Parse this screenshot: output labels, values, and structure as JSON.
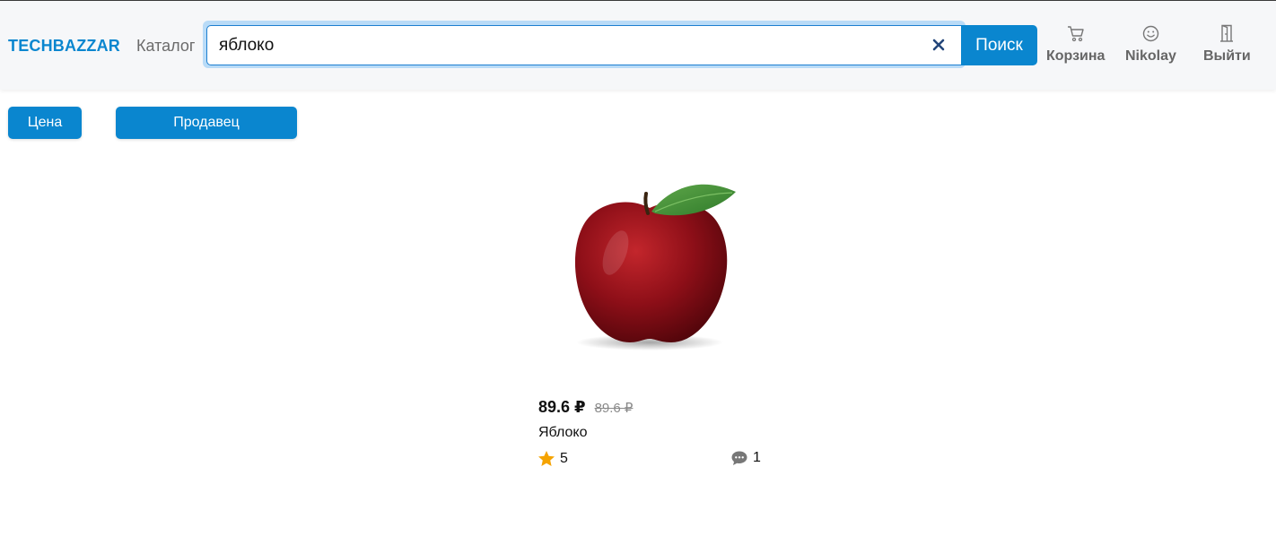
{
  "header": {
    "logo": "TECHBAZZAR",
    "catalog": "Каталог",
    "search": {
      "value": "яблоко",
      "button": "Поиск"
    },
    "nav": {
      "cart": {
        "label": "Корзина",
        "icon": "cart-icon"
      },
      "user": {
        "label": "Nikolay",
        "icon": "smiley-icon"
      },
      "logout": {
        "label": "Выйти",
        "icon": "door-icon"
      }
    }
  },
  "filters": {
    "price": "Цена",
    "seller": "Продавец"
  },
  "products": [
    {
      "image": "apple-image",
      "price": "89.6 ₽",
      "old_price": "89.6 ₽",
      "title": "Яблоко",
      "rating": "5",
      "reviews": "1"
    }
  ],
  "colors": {
    "accent": "#0a86cf",
    "header_bg": "#f6f7f9",
    "star": "#f5a300"
  }
}
